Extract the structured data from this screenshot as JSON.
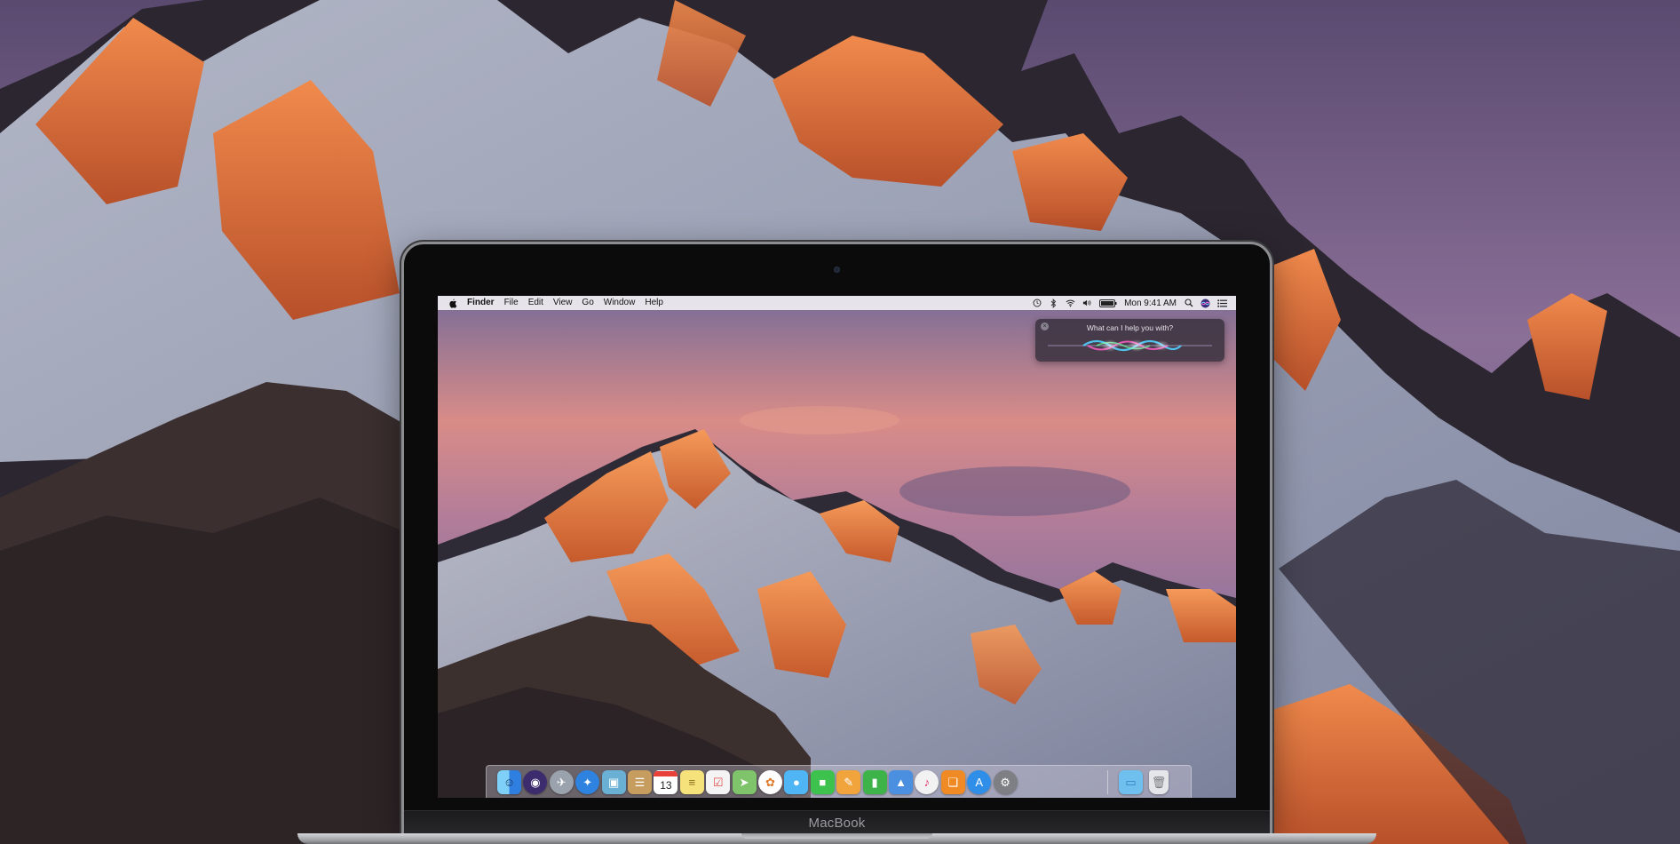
{
  "menubar": {
    "app_name": "Finder",
    "menus": [
      "File",
      "Edit",
      "View",
      "Go",
      "Window",
      "Help"
    ],
    "clock": "Mon 9:41 AM",
    "status_icons": [
      "time-machine-icon",
      "bluetooth-icon",
      "wifi-icon",
      "volume-icon",
      "battery-icon",
      "spotlight-icon",
      "siri-icon",
      "notification-center-icon"
    ]
  },
  "siri": {
    "prompt": "What can I help you with?",
    "close_glyph": "×"
  },
  "dock": {
    "apps": [
      {
        "name": "Finder",
        "icon": "finder-icon",
        "color": "#3b8fe5"
      },
      {
        "name": "Siri",
        "icon": "siri-icon",
        "color": "#3c2c6e"
      },
      {
        "name": "Launchpad",
        "icon": "launchpad-icon",
        "color": "#9aa3ad"
      },
      {
        "name": "Safari",
        "icon": "safari-icon",
        "color": "#2f83e0"
      },
      {
        "name": "Preview",
        "icon": "photos-preview-icon",
        "color": "#6ab0d4"
      },
      {
        "name": "Contacts",
        "icon": "contacts-icon",
        "color": "#c79d5f"
      },
      {
        "name": "Calendar",
        "icon": "calendar-icon",
        "color": "#ffffff",
        "text": "13"
      },
      {
        "name": "Notes",
        "icon": "notes-icon",
        "color": "#f6e27a"
      },
      {
        "name": "Reminders",
        "icon": "reminders-icon",
        "color": "#f4f4f4"
      },
      {
        "name": "Maps",
        "icon": "maps-icon",
        "color": "#7fc46b"
      },
      {
        "name": "Photos",
        "icon": "photos-icon",
        "color": "#ffffff"
      },
      {
        "name": "Messages",
        "icon": "messages-icon",
        "color": "#4fb5f5"
      },
      {
        "name": "FaceTime",
        "icon": "facetime-icon",
        "color": "#3ec24e"
      },
      {
        "name": "Pages",
        "icon": "pages-icon",
        "color": "#f1a33c"
      },
      {
        "name": "Numbers",
        "icon": "numbers-icon",
        "color": "#3eb34a"
      },
      {
        "name": "Keynote",
        "icon": "keynote-icon",
        "color": "#4a8fe0"
      },
      {
        "name": "iTunes",
        "icon": "itunes-icon",
        "color": "#f2f2f2"
      },
      {
        "name": "iBooks",
        "icon": "ibooks-icon",
        "color": "#f08a24"
      },
      {
        "name": "App Store",
        "icon": "app-store-icon",
        "color": "#2f8ee8"
      },
      {
        "name": "System Preferences",
        "icon": "system-preferences-icon",
        "color": "#7d7f84"
      }
    ],
    "stack": [
      {
        "name": "Downloads",
        "icon": "folder-icon",
        "color": "#6fc0ee"
      },
      {
        "name": "Trash",
        "icon": "trash-icon",
        "color": "#e4e6ea"
      }
    ]
  },
  "laptop_label": "MacBook",
  "colors": {
    "sky_top": "#8a7aa0",
    "sky_glow": "#e89a86",
    "peak_lit": "#e0703a",
    "snow": "#d8dce8",
    "rock": "#3a3036"
  }
}
